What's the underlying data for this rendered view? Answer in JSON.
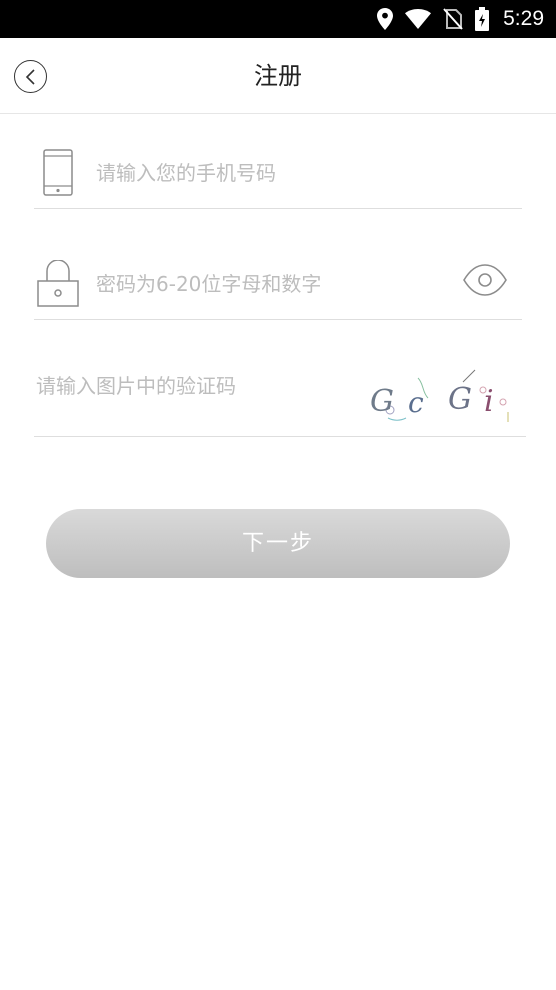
{
  "status_bar": {
    "time": "5:29",
    "icons": [
      "location-icon",
      "wifi-icon",
      "no-sim-icon",
      "battery-charging-icon"
    ]
  },
  "header": {
    "title": "注册",
    "back_icon": "chevron-left-circle-icon"
  },
  "form": {
    "phone": {
      "placeholder": "请输入您的手机号码",
      "value": "",
      "icon": "phone-icon"
    },
    "password": {
      "placeholder": "密码为6-20位字母和数字",
      "value": "",
      "icon": "lock-icon",
      "toggle_icon": "eye-icon"
    },
    "captcha": {
      "placeholder": "请输入图片中的验证码",
      "value": "",
      "image_text": [
        "G",
        "c",
        "G",
        "i"
      ]
    },
    "next_label": "下一步"
  },
  "colors": {
    "status_bar_bg": "#000000",
    "placeholder": "#bdbdbd",
    "divider": "#dedede",
    "button_gradient_top": "#d9d9d9",
    "button_gradient_bottom": "#bebebe"
  }
}
